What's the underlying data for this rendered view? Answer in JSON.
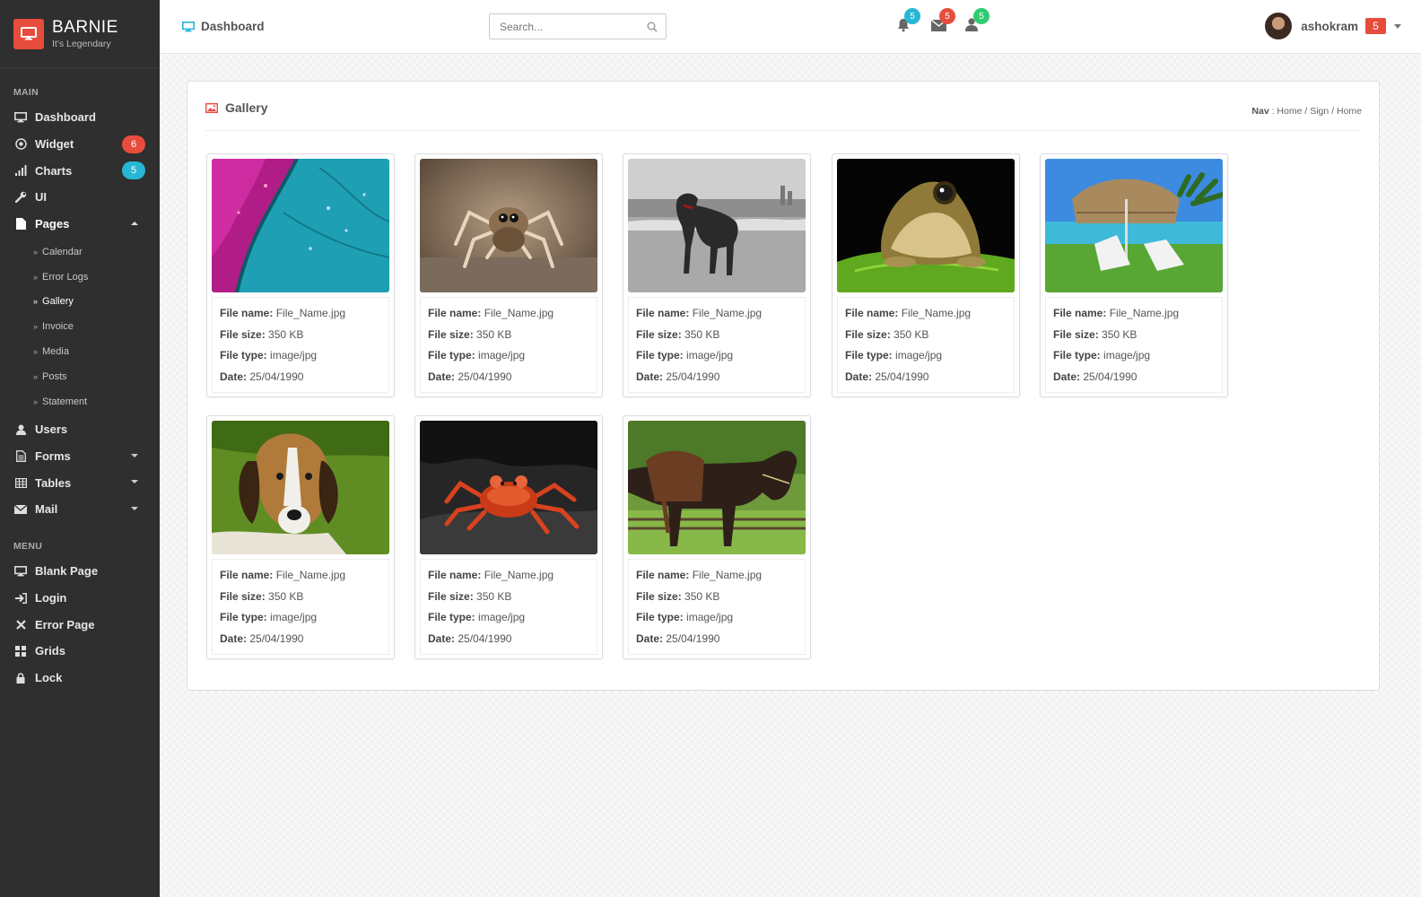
{
  "brand": {
    "name": "BARNIE",
    "tagline": "It's Legendary",
    "color": "#e84c3d"
  },
  "sidebar": {
    "sections": {
      "main": "MAIN",
      "menu": "MENU"
    },
    "main_items": [
      {
        "label": "Dashboard",
        "icon": "monitor-icon"
      },
      {
        "label": "Widget",
        "icon": "target-icon",
        "badge": "6",
        "badge_color": "#e84c3d"
      },
      {
        "label": "Charts",
        "icon": "bar-chart-icon",
        "badge": "5",
        "badge_color": "#27b6d6"
      },
      {
        "label": "UI",
        "icon": "wrench-icon"
      },
      {
        "label": "Pages",
        "icon": "file-icon",
        "expanded": true
      }
    ],
    "pages_sub": [
      "Calendar",
      "Error Logs",
      "Gallery",
      "Invoice",
      "Media",
      "Posts",
      "Statement"
    ],
    "pages_active": "Gallery",
    "more_items": [
      {
        "label": "Users",
        "icon": "user-icon"
      },
      {
        "label": "Forms",
        "icon": "document-icon"
      },
      {
        "label": "Tables",
        "icon": "table-icon"
      },
      {
        "label": "Mail",
        "icon": "envelope-icon"
      }
    ],
    "menu_items": [
      {
        "label": "Blank Page",
        "icon": "monitor-icon"
      },
      {
        "label": "Login",
        "icon": "sign-in-icon"
      },
      {
        "label": "Error Page",
        "icon": "x-icon"
      },
      {
        "label": "Grids",
        "icon": "grid-icon"
      },
      {
        "label": "Lock",
        "icon": "lock-icon"
      }
    ]
  },
  "topbar": {
    "title": "Dashboard",
    "search_placeholder": "Search...",
    "notifications": [
      {
        "icon": "bell-icon",
        "count": "5",
        "color": "#27b6d6"
      },
      {
        "icon": "envelope-icon",
        "count": "5",
        "color": "#e84c3d"
      },
      {
        "icon": "user-icon",
        "count": "5",
        "color": "#2ecc71"
      }
    ],
    "username": "ashokram",
    "user_badge": "5"
  },
  "panel": {
    "title": "Gallery",
    "breadcrumb": {
      "label": "Nav",
      "sep": ":",
      "items": [
        "Home",
        "Sign",
        "Home"
      ]
    }
  },
  "gallery": {
    "labels": {
      "name": "File name:",
      "size": "File size:",
      "type": "File type:",
      "date": "Date:"
    },
    "items": [
      {
        "image": "feather-macro",
        "name": "File_Name.jpg",
        "size": "350 KB",
        "type": "image/jpg",
        "date": "25/04/1990"
      },
      {
        "image": "jumping-spider",
        "name": "File_Name.jpg",
        "size": "350 KB",
        "type": "image/jpg",
        "date": "25/04/1990"
      },
      {
        "image": "dog-on-beach",
        "name": "File_Name.jpg",
        "size": "350 KB",
        "type": "image/jpg",
        "date": "25/04/1990"
      },
      {
        "image": "frog-on-leaf",
        "name": "File_Name.jpg",
        "size": "350 KB",
        "type": "image/jpg",
        "date": "25/04/1990"
      },
      {
        "image": "pool-umbrella",
        "name": "File_Name.jpg",
        "size": "350 KB",
        "type": "image/jpg",
        "date": "25/04/1990"
      },
      {
        "image": "beagle-puppy",
        "name": "File_Name.jpg",
        "size": "350 KB",
        "type": "image/jpg",
        "date": "25/04/1990"
      },
      {
        "image": "red-crab",
        "name": "File_Name.jpg",
        "size": "350 KB",
        "type": "image/jpg",
        "date": "25/04/1990"
      },
      {
        "image": "saddled-horse",
        "name": "File_Name.jpg",
        "size": "350 KB",
        "type": "image/jpg",
        "date": "25/04/1990"
      }
    ]
  }
}
